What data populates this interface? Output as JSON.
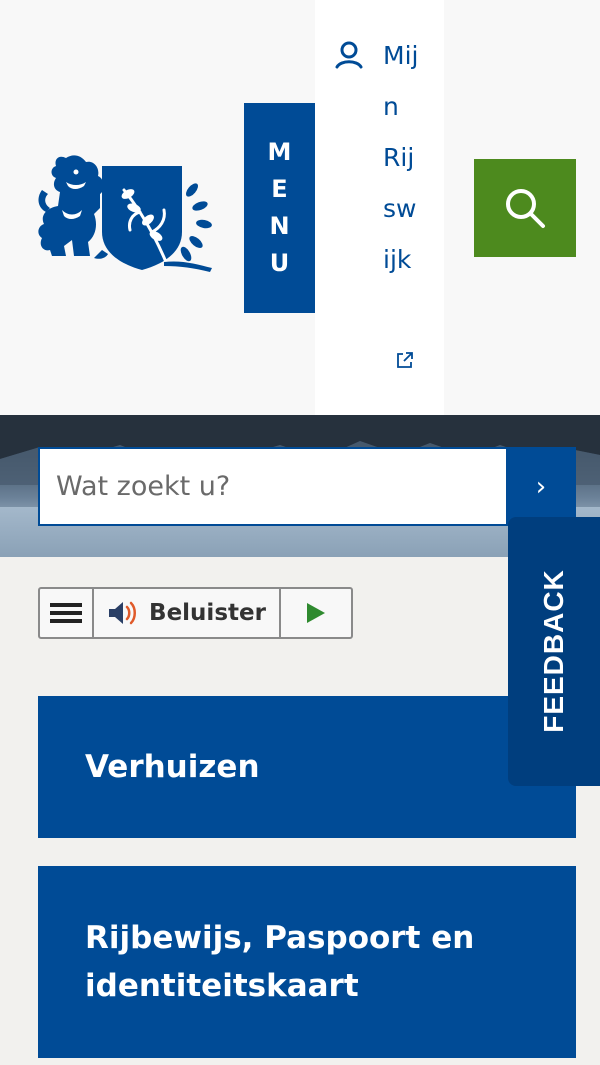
{
  "header": {
    "menu_label": "MENU",
    "account_link": "Mijn Rijswijk",
    "logo_alt": "Gemeente Rijswijk"
  },
  "search": {
    "placeholder": "Wat zoekt u?",
    "submit_label": "›"
  },
  "readspeaker": {
    "listen_label": "Beluister"
  },
  "tiles": [
    {
      "label": "Verhuizen"
    },
    {
      "label": "Rijbewijs, Paspoort en identiteitskaart"
    }
  ],
  "feedback": {
    "label": "FEEDBACK"
  },
  "colors": {
    "brand_blue": "#004b96",
    "search_green": "#4d8a1e",
    "feedback_blue": "#003e7e",
    "page_bg": "#f2f1ee"
  },
  "icons": [
    "user-icon",
    "external-link-icon",
    "search-icon",
    "hamburger-icon",
    "speaker-icon",
    "play-icon",
    "chevron-right-icon"
  ]
}
